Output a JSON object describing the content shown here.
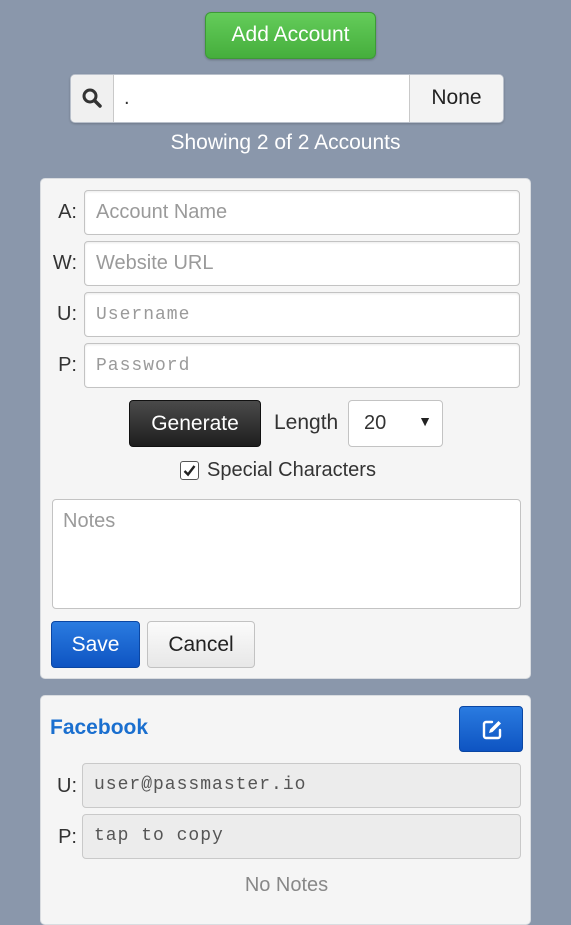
{
  "header": {
    "add_account_label": "Add Account"
  },
  "search": {
    "value": ".",
    "placeholder": "",
    "none_label": "None",
    "icon": "search-icon"
  },
  "status": {
    "showing_text": "Showing 2 of 2 Accounts"
  },
  "form": {
    "rows": [
      {
        "label": "A:",
        "placeholder": "Account Name"
      },
      {
        "label": "W:",
        "placeholder": "Website URL"
      },
      {
        "label": "U:",
        "placeholder": "Username"
      },
      {
        "label": "P:",
        "placeholder": "Password"
      }
    ],
    "generate_label": "Generate",
    "length_label": "Length",
    "length_value": "20",
    "special_label": "Special Characters",
    "special_checked": true,
    "notes_placeholder": "Notes",
    "save_label": "Save",
    "cancel_label": "Cancel"
  },
  "accounts": [
    {
      "name": "Facebook",
      "u_label": "U:",
      "username": "user@passmaster.io",
      "p_label": "P:",
      "password_hint": "tap to copy",
      "notes": "No Notes",
      "edit_icon": "edit-icon"
    }
  ],
  "colors": {
    "background": "#8a97ab",
    "add_button": "#4fbd45",
    "primary_blue": "#1a63d4",
    "link_blue": "#1a6fcf",
    "generate_button": "#2b2b2b"
  }
}
